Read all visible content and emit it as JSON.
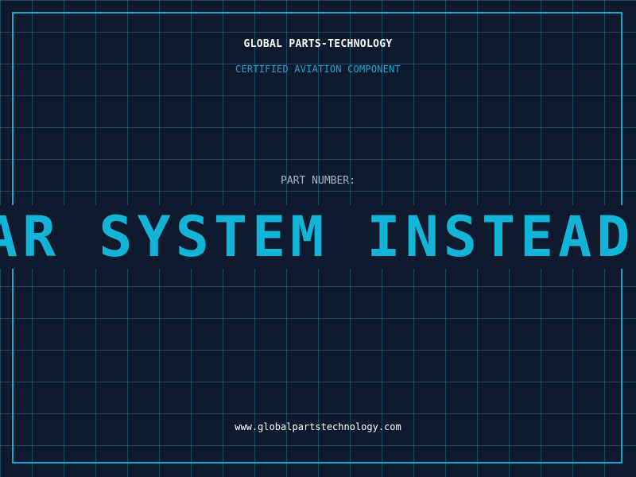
{
  "header": {
    "company": "GLOBAL PARTS-TECHNOLOGY",
    "subtitle": "CERTIFIED AVIATION COMPONENT"
  },
  "part": {
    "label": "PART NUMBER:",
    "ticker_text": "AR SYSTEM INSTEAD O"
  },
  "footer": {
    "website": "www.globalpartstechnology.com"
  },
  "colors": {
    "background": "#0f1a2e",
    "accent": "#1fa6cf",
    "ticker": "#12b4d8",
    "grid": "#286e8c"
  }
}
